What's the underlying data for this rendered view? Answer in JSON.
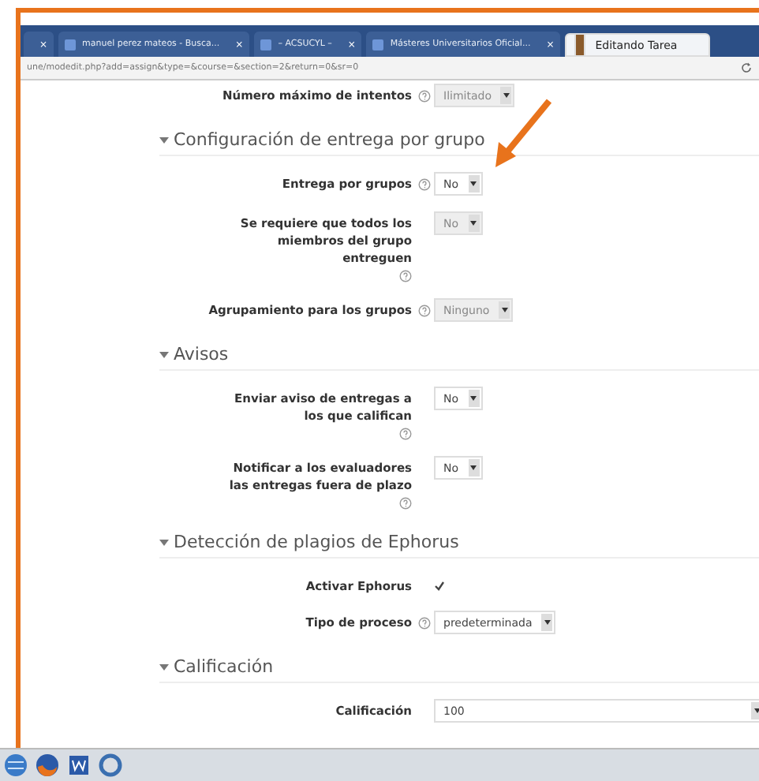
{
  "browser": {
    "tabs": [
      {
        "close": "×",
        "selected": false
      },
      {
        "title": "manuel perez mateos - Busca...",
        "close": "×",
        "selected": false
      },
      {
        "title": "– ACSUCYL –",
        "close": "×",
        "selected": false
      },
      {
        "title": "Másteres Universitarios Oficial...",
        "close": "×",
        "selected": false
      },
      {
        "title": "Editando Tarea",
        "selected": true
      }
    ],
    "url": "une/modedit.php?add=assign&type=&course=&section=2&return=0&sr=0"
  },
  "top_row": {
    "label": "Número máximo de intentos",
    "value": "Ilimitado"
  },
  "sections": [
    {
      "title": "Configuración de entrega por grupo",
      "fields": [
        {
          "kind": "select",
          "label": "Entrega por grupos",
          "help": true,
          "value": "No",
          "disabled": false
        },
        {
          "kind": "select",
          "label": "Se requiere que todos los miembros del grupo entreguen",
          "help": true,
          "value": "No",
          "disabled": true
        },
        {
          "kind": "select",
          "label": "Agrupamiento para los grupos",
          "help": true,
          "value": "Ninguno",
          "disabled": true
        }
      ]
    },
    {
      "title": "Avisos",
      "fields": [
        {
          "kind": "select",
          "label": "Enviar aviso de entregas a los que califican",
          "help": true,
          "value": "No",
          "disabled": false
        },
        {
          "kind": "select",
          "label": "Notificar a los evaluadores las entregas fuera de plazo",
          "help": true,
          "value": "No",
          "disabled": false
        }
      ]
    },
    {
      "title": "Detección de plagios de Ephorus",
      "fields": [
        {
          "kind": "checkbox",
          "label": "Activar Ephorus",
          "help": false,
          "checked": true
        },
        {
          "kind": "select",
          "label": "Tipo de proceso",
          "help": true,
          "value": "predeterminada",
          "disabled": false
        }
      ]
    },
    {
      "title": "Calificación",
      "fields": [
        {
          "kind": "wide-select",
          "label": "Calificación",
          "help": false,
          "value": "100",
          "disabled": false
        }
      ]
    }
  ]
}
